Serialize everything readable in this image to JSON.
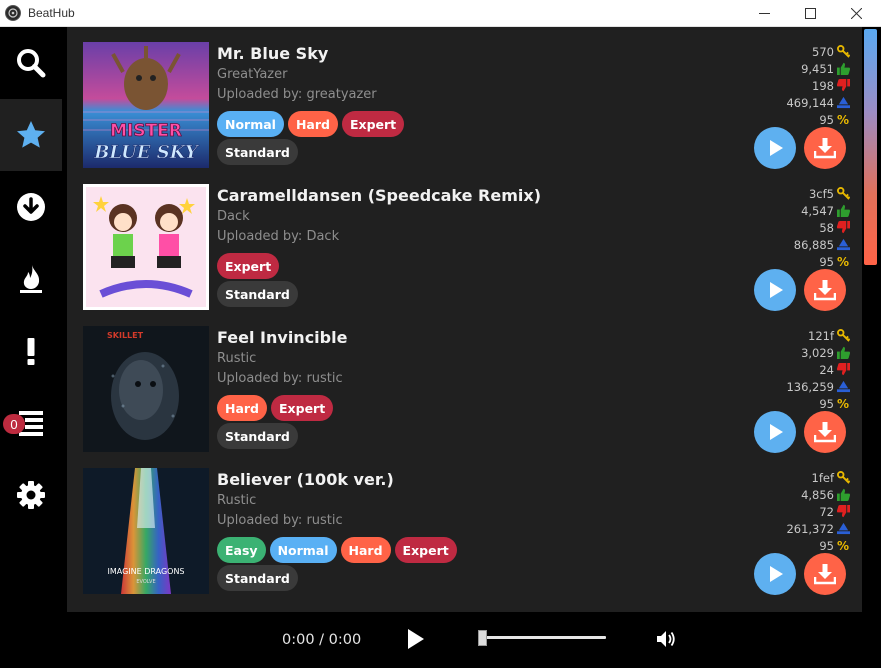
{
  "window": {
    "title": "BeatHub"
  },
  "sidebar": {
    "items": [
      {
        "name": "search",
        "icon": "search-icon"
      },
      {
        "name": "favorites",
        "icon": "star-icon",
        "active": true
      },
      {
        "name": "downloads",
        "icon": "download-circle-icon"
      },
      {
        "name": "hot",
        "icon": "flame-icon"
      },
      {
        "name": "alerts",
        "icon": "exclamation-icon"
      },
      {
        "name": "queue",
        "icon": "queue-list-icon",
        "badge": "0"
      },
      {
        "name": "settings",
        "icon": "gear-icon"
      }
    ]
  },
  "colors": {
    "easy": "#3bb273",
    "normal": "#59b0f4",
    "hard": "#ff6347",
    "expert": "#bf2a42",
    "play_button": "#5eb0f0",
    "download_button": "#ff6347",
    "key_icon": "#e8b800",
    "upvote_icon": "#2e9e2e",
    "downvote_icon": "#e02020",
    "plays_icon": "#2a5fd6"
  },
  "songs": [
    {
      "title": "Mr. Blue Sky",
      "artist": "GreatYazer",
      "uploader_prefix": "Uploaded by:",
      "uploader": "greatyazer",
      "difficulties": [
        "Normal",
        "Hard",
        "Expert"
      ],
      "characteristic": "Standard",
      "cover_text": [
        "MISTER",
        "BLUE SKY"
      ],
      "stats": {
        "key": "570",
        "upvotes": "9,451",
        "downvotes": "198",
        "plays": "469,144",
        "rating": "95"
      }
    },
    {
      "title": "Caramelldansen (Speedcake Remix)",
      "artist": "Dack",
      "uploader_prefix": "Uploaded by:",
      "uploader": "Dack",
      "difficulties": [
        "Expert"
      ],
      "characteristic": "Standard",
      "cover_text": [],
      "stats": {
        "key": "3cf5",
        "upvotes": "4,547",
        "downvotes": "58",
        "plays": "86,885",
        "rating": "95"
      }
    },
    {
      "title": "Feel Invincible",
      "artist": "Rustic",
      "uploader_prefix": "Uploaded by:",
      "uploader": "rustic",
      "difficulties": [
        "Hard",
        "Expert"
      ],
      "characteristic": "Standard",
      "cover_text": [
        "SKILLET"
      ],
      "stats": {
        "key": "121f",
        "upvotes": "3,029",
        "downvotes": "24",
        "plays": "136,259",
        "rating": "95"
      }
    },
    {
      "title": "Believer (100k ver.)",
      "artist": "Rustic",
      "uploader_prefix": "Uploaded by:",
      "uploader": "rustic",
      "difficulties": [
        "Easy",
        "Normal",
        "Hard",
        "Expert"
      ],
      "characteristic": "Standard",
      "cover_text": [
        "IMAGINE DRAGONS",
        "EVOLVE"
      ],
      "stats": {
        "key": "1fef",
        "upvotes": "4,856",
        "downvotes": "72",
        "plays": "261,372",
        "rating": "95"
      }
    }
  ],
  "player": {
    "time": "0:00 / 0:00",
    "progress": 0,
    "play_icon": "play-icon",
    "volume_icon": "volume-icon"
  }
}
